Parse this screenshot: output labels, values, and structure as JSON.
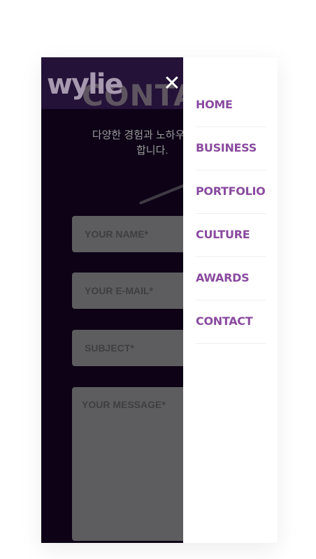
{
  "brand": {
    "logo_text": "wylie"
  },
  "page": {
    "title": "CONTAC",
    "intro_line1": "다양한 경험과 노하우로",
    "intro_line2": "합니다."
  },
  "form": {
    "name_placeholder": "YOUR NAME*",
    "email_placeholder": "YOUR E-MAIL*",
    "subject_placeholder": "SUBJECT*",
    "message_placeholder": "YOUR MESSAGE*"
  },
  "menu": {
    "close_icon": "close-icon",
    "items": [
      {
        "label": "HOME"
      },
      {
        "label": "BUSINESS"
      },
      {
        "label": "PORTFOLIO"
      },
      {
        "label": "CULTURE"
      },
      {
        "label": "AWARDS"
      },
      {
        "label": "CONTACT"
      }
    ]
  },
  "colors": {
    "accent": "#8a4b9f",
    "background_dark": "#0d0216",
    "header": "#241238"
  }
}
